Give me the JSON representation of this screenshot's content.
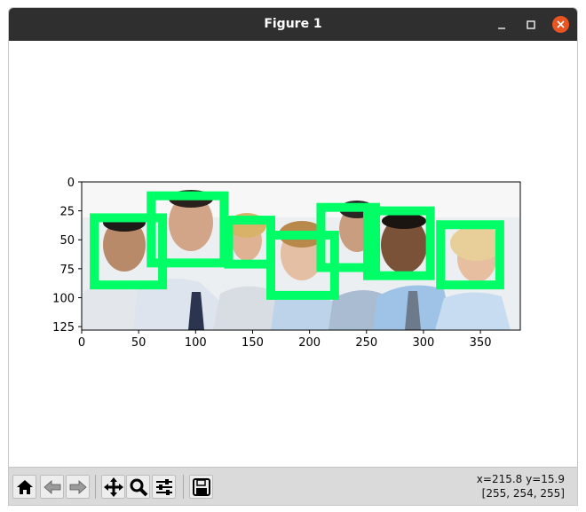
{
  "window": {
    "title": "Figure 1",
    "controls": [
      "minimize-icon",
      "maximize-icon",
      "close-icon"
    ],
    "close_color": "#e95420"
  },
  "axes": {
    "x_ticks": [
      "0",
      "50",
      "100",
      "150",
      "200",
      "250",
      "300",
      "350"
    ],
    "y_ticks": [
      "0",
      "25",
      "50",
      "75",
      "100",
      "125"
    ],
    "x_range": [
      0,
      385
    ],
    "y_range": [
      128,
      0
    ],
    "detection_box_color": "#00ff66",
    "detections": [
      {
        "x0": 11,
        "y0": 31,
        "x1": 71,
        "y1": 89
      },
      {
        "x0": 61,
        "y0": 12,
        "x1": 125,
        "y1": 70
      },
      {
        "x0": 129,
        "y0": 33,
        "x1": 166,
        "y1": 71
      },
      {
        "x0": 166,
        "y0": 46,
        "x1": 222,
        "y1": 98
      },
      {
        "x0": 210,
        "y0": 22,
        "x1": 258,
        "y1": 74
      },
      {
        "x0": 251,
        "y0": 25,
        "x1": 306,
        "y1": 81
      },
      {
        "x0": 315,
        "y0": 37,
        "x1": 367,
        "y1": 89
      }
    ]
  },
  "toolbar": {
    "buttons": [
      "home-icon",
      "back-icon",
      "forward-icon",
      "pan-icon",
      "zoom-icon",
      "configure-subplots-icon",
      "save-icon"
    ],
    "coords_line1": "x=215.8 y=15.9",
    "coords_line2": "[255, 254, 255]"
  }
}
